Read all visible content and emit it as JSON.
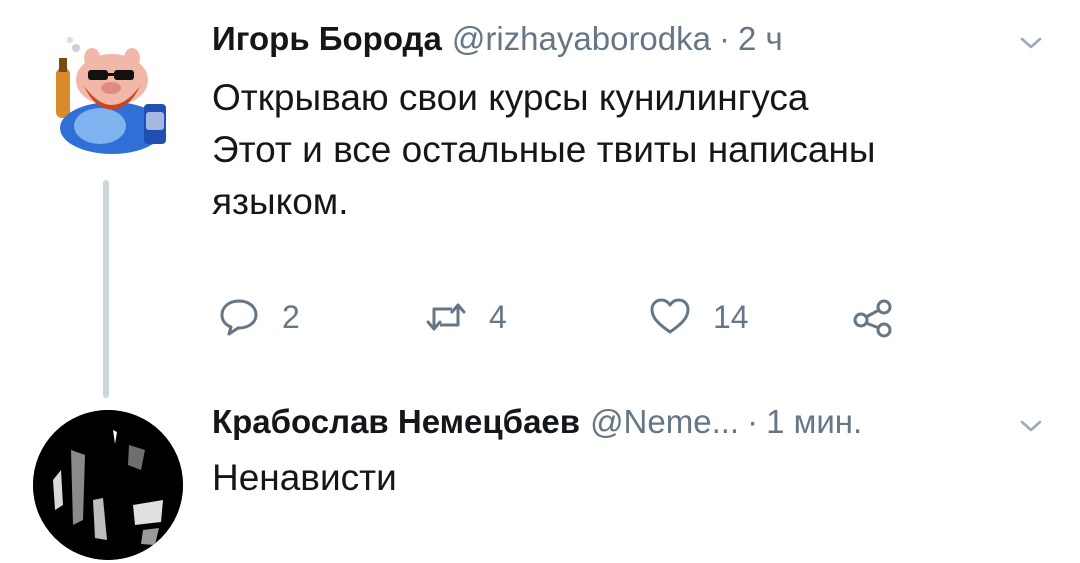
{
  "tweets": [
    {
      "author": "Игорь Борода",
      "handle": "@rizhayaborodka",
      "separator": "·",
      "time": "2 ч",
      "lines": [
        "Открываю свои курсы кунилингуса",
        "Этот и все остальные твиты написаны",
        "языком."
      ],
      "avatar_icon": "cartoon-pig-avatar",
      "actions": {
        "reply_count": "2",
        "retweet_count": "4",
        "like_count": "14"
      }
    },
    {
      "author": "Крабослав Немецбаев",
      "handle": "@Neme...",
      "separator": "·",
      "time": "1 мин.",
      "lines": [
        "Ненависти"
      ],
      "avatar_icon": "dark-photo-avatar"
    }
  ],
  "colors": {
    "text": "#14171a",
    "secondary": "#657786",
    "thread_line": "#ccd6dd"
  }
}
